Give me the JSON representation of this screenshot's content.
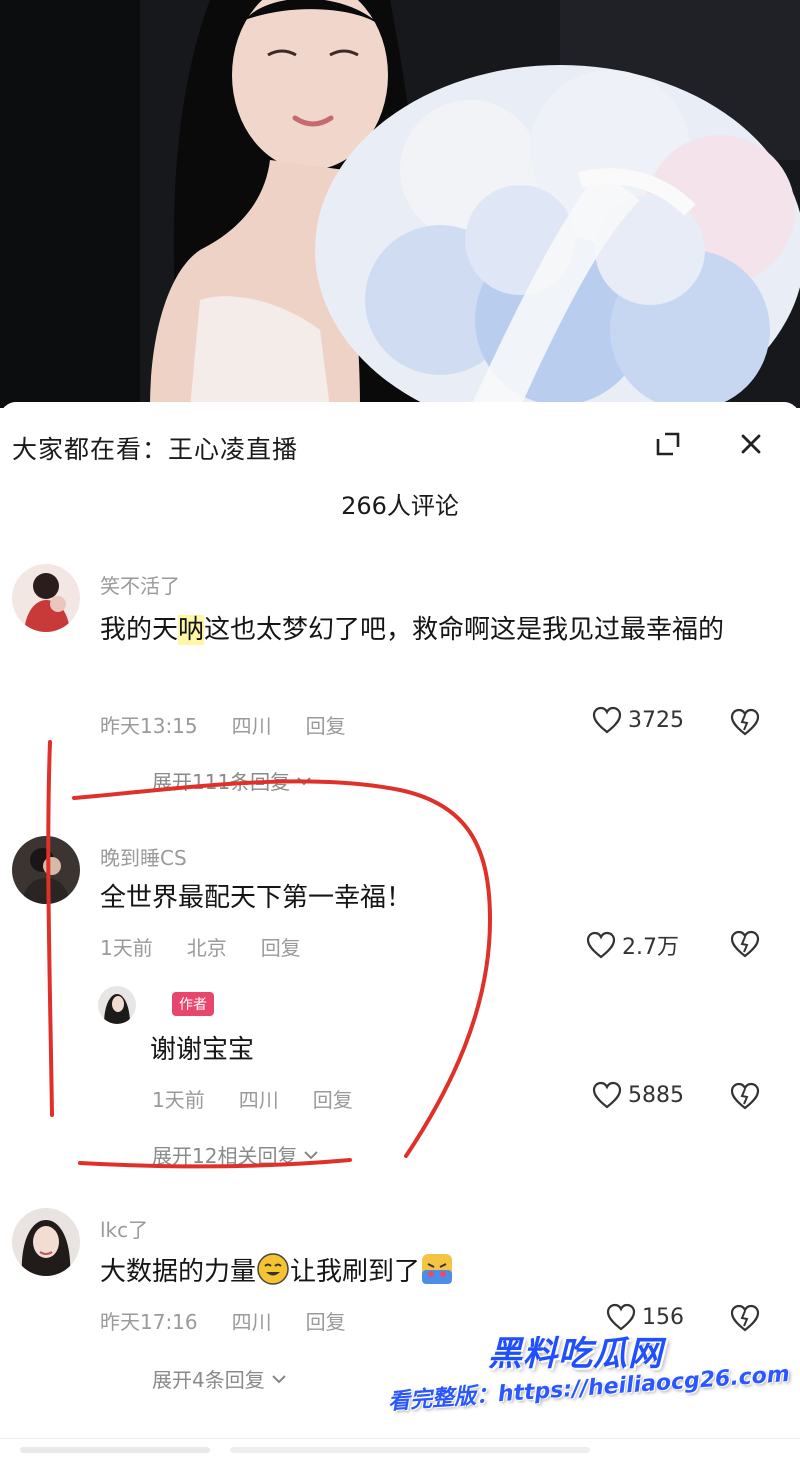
{
  "header": {
    "title": "大家都在看：王心凌直播",
    "comment_count": "266人评论"
  },
  "comments": [
    {
      "username": "笑不活了",
      "text_before": "我的天",
      "text_highlight": "呐",
      "text_after": "这也太梦幻了吧，救命啊这是我见过最幸福的",
      "time": "昨天13:15",
      "location": "四川",
      "reply_label": "回复",
      "likes": "3725",
      "expand_label": "展开111条回复"
    },
    {
      "username": "晚到睡CS",
      "text": "全世界最配天下第一幸福！",
      "time": "1天前",
      "location": "北京",
      "reply_label": "回复",
      "likes": "2.7万"
    },
    {
      "username": "",
      "badge": "作者",
      "text": "谢谢宝宝",
      "time": "1天前",
      "location": "四川",
      "reply_label": "回复",
      "likes": "5885",
      "expand_label": "展开12相关回复"
    },
    {
      "username": "lkc了",
      "text_before": "大数据的力量",
      "text_after": "让我刷到了",
      "time": "昨天17:16",
      "location": "四川",
      "reply_label": "回复",
      "likes": "156",
      "expand_label": "展开4条回复"
    }
  ],
  "watermark": {
    "brand": "黑料吃瓜网",
    "url": "看完整版：https://heiliaocg26.com"
  },
  "colors": {
    "annotation": "#e0302a",
    "badge": "#e8466b",
    "watermark": "#1f4fff"
  }
}
